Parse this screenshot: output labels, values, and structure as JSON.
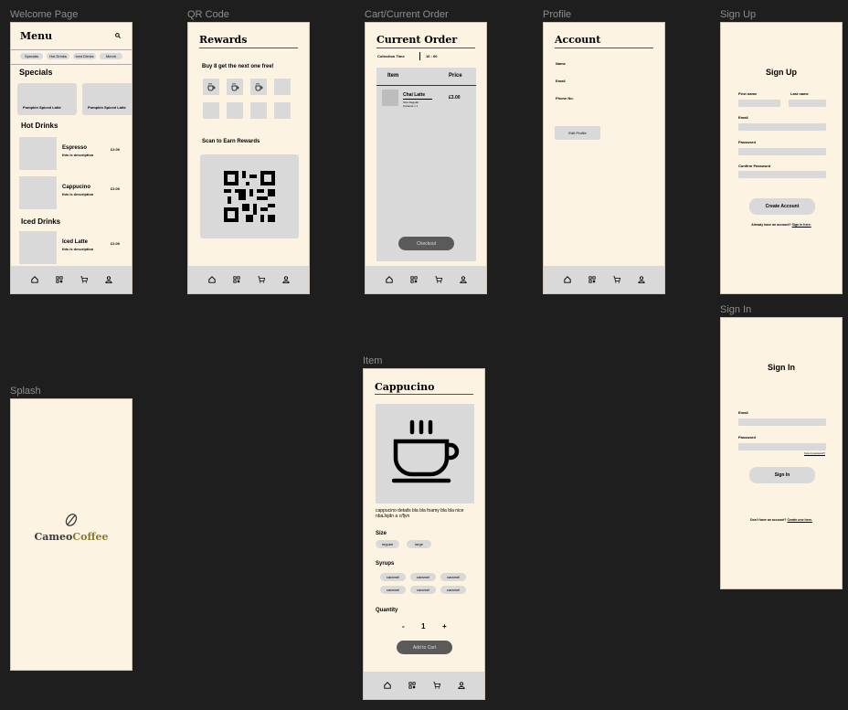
{
  "frames": {
    "welcome": "Welcome Page",
    "qr": "QR Code",
    "cart": "Cart/Current Order",
    "profile": "Profile",
    "signup": "Sign Up",
    "signin": "Sign In",
    "splash": "Splash",
    "item": "Item"
  },
  "welcome": {
    "title": "Menu",
    "chips": [
      "Specials",
      "Hot Drinks",
      "Iced Drinks",
      "Merch"
    ],
    "specials_heading": "Specials",
    "specials": [
      "Pumpkin Spiced Latte",
      "Pumpkin Spiced Latte"
    ],
    "hot_heading": "Hot Drinks",
    "hot": [
      {
        "name": "Espresso",
        "desc": "this is description",
        "price": "£2.00"
      },
      {
        "name": "Cappucino",
        "desc": "this is description",
        "price": "£2.00"
      }
    ],
    "iced_heading": "Iced Drinks",
    "iced": [
      {
        "name": "Iced Latte",
        "desc": "this is description",
        "price": "£2.00"
      }
    ]
  },
  "rewards": {
    "title": "Rewards",
    "promo": "Buy 8 get the next one free!",
    "stamps_filled": 3,
    "stamps_total": 8,
    "scan": "Scan to Earn Rewards"
  },
  "cart": {
    "title": "Current Order",
    "collection_label": "Collection Time",
    "collection_time": "16 : 00",
    "col_item": "Item",
    "col_price": "Price",
    "line_name": "Chai Latte",
    "line_opt1": "Size Regular",
    "line_opt2": "Caramel x 1",
    "line_price": "£3.00",
    "checkout": "Checkout"
  },
  "profile": {
    "title": "Account",
    "fields": [
      "Name",
      "Email",
      "Phone No."
    ],
    "edit": "Edit Profile"
  },
  "signup": {
    "title": "Sign Up",
    "first": "First name",
    "last": "Last name",
    "email": "Email",
    "password": "Password",
    "confirm": "Confirm Password",
    "button": "Create Account",
    "footer_text": "Already have an account?",
    "footer_link": "Sign in here."
  },
  "signin": {
    "title": "Sign In",
    "email": "Email",
    "password": "Password",
    "forgot": "forgot password?",
    "button": "Sign In",
    "footer_text": "Don't have an account?",
    "footer_link": "Create one here."
  },
  "splash": {
    "brand_a": "Cameo",
    "brand_b": "Coffee",
    "brand_color": "#8a7a2e"
  },
  "item": {
    "title": "Cappucino",
    "desc": "cappucino details bla bla foamy bla bla nice nbaJsjdn a c/fjvn",
    "size_heading": "Size",
    "sizes": [
      "regular",
      "large"
    ],
    "syrups_heading": "Syrups",
    "syrups": [
      "caramel",
      "caramel",
      "caramel",
      "caramel",
      "caramel",
      "caramel"
    ],
    "qty_heading": "Quantity",
    "minus": "-",
    "qty": "1",
    "plus": "+",
    "add": "Add to Cart"
  },
  "nav_icons": [
    "home-icon",
    "qr-icon",
    "cart-icon",
    "user-icon"
  ]
}
